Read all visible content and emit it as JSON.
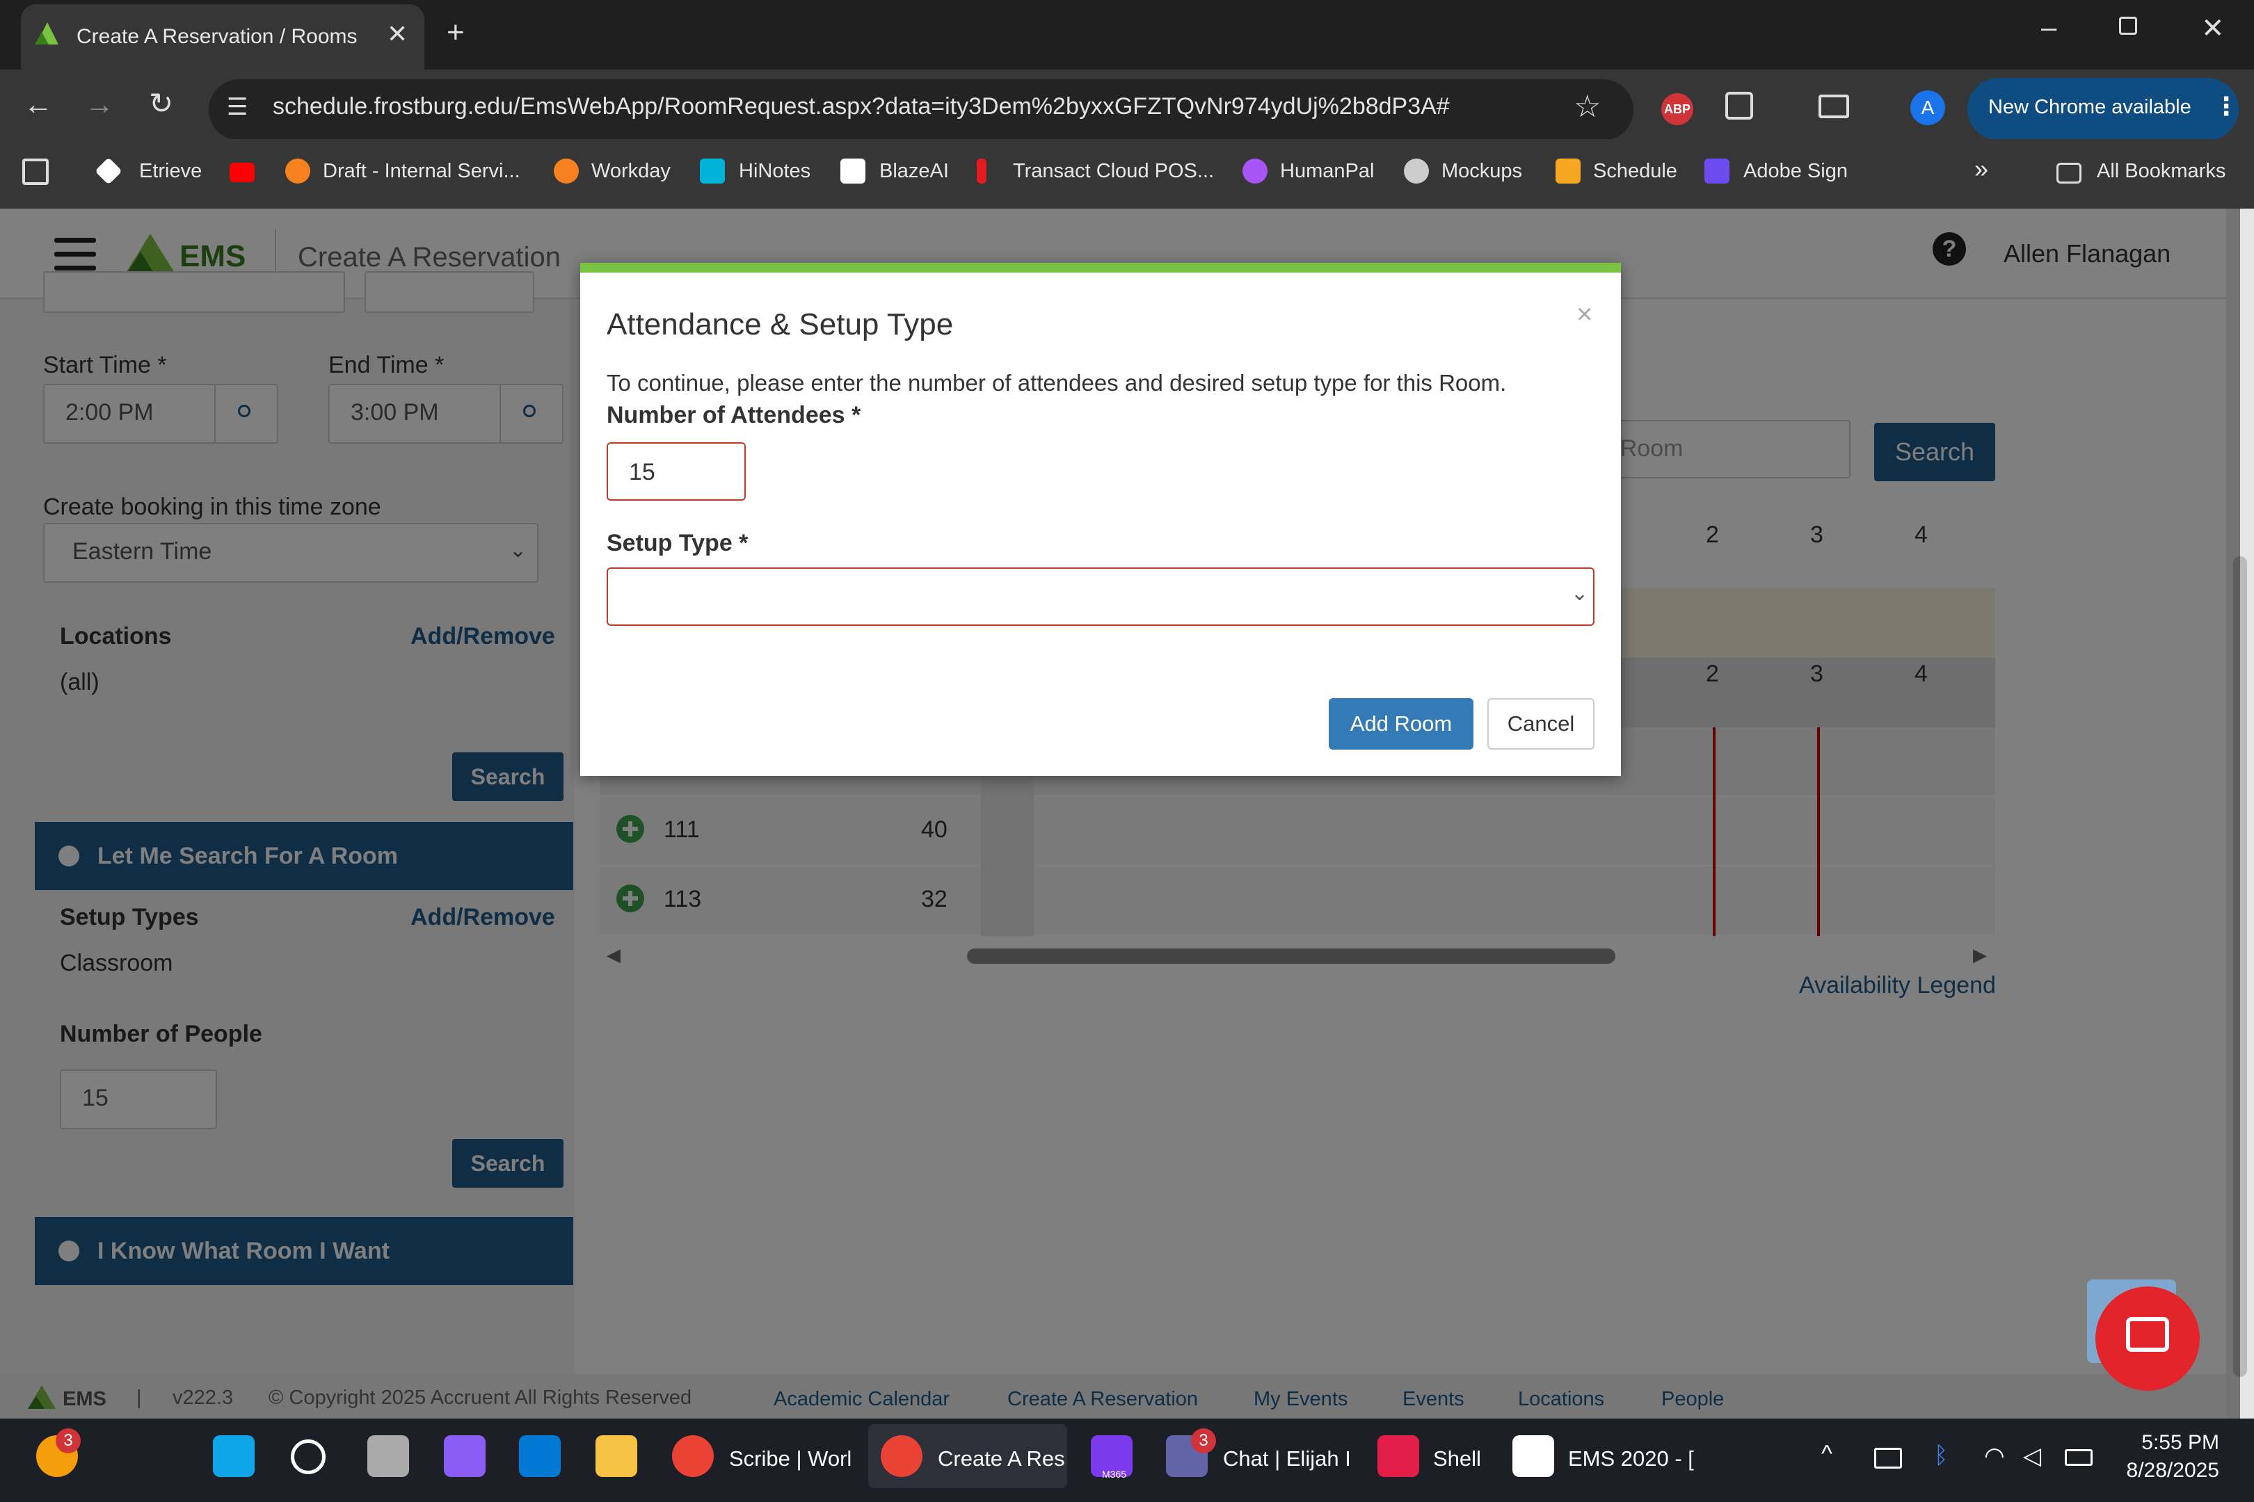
{
  "browser": {
    "tab_title": "Create A Reservation / Rooms",
    "url": "schedule.frostburg.edu/EmsWebApp/RoomRequest.aspx?data=ity3Dem%2byxxGFZTQvNr974ydUj%2b8dP3A#",
    "new_chrome": "New Chrome available",
    "profile_initial": "A",
    "abp": "ABP",
    "bookmarks": [
      "Etrieve",
      "Draft - Internal Servi...",
      "Workday",
      "HiNotes",
      "BlazeAI",
      "Transact Cloud POS...",
      "HumanPal",
      "Mockups",
      "Schedule",
      "Adobe Sign"
    ],
    "all_bookmarks": "All Bookmarks",
    "more": "»"
  },
  "header": {
    "logo": "EMS",
    "title": "Create A Reservation",
    "user": "Allen Flanagan",
    "help": "?"
  },
  "left": {
    "start_label": "Start Time *",
    "start_value": "2:00 PM",
    "end_label": "End Time *",
    "end_value": "3:00 PM",
    "tz_label": "Create booking in this time zone",
    "tz_value": "Eastern Time",
    "locations_label": "Locations",
    "add_remove": "Add/Remove",
    "locations_value": "(all)",
    "search": "Search",
    "panel1": "Let Me Search For A Room",
    "setup_label": "Setup Types",
    "setup_value": "Classroom",
    "people_label": "Number of People",
    "people_value": "15",
    "panel2": "I Know What Room I Want"
  },
  "grid": {
    "search_placeholder": "d A Room",
    "search_btn": "Search",
    "hours": [
      "2",
      "3",
      "4"
    ],
    "rows": [
      {
        "room": "111",
        "cap": "40"
      },
      {
        "room": "113",
        "cap": "32"
      }
    ],
    "legend": "Availability Legend"
  },
  "modal": {
    "title": "Attendance & Setup Type",
    "close": "×",
    "desc": "To continue, please enter the number of attendees and desired setup type for this Room.",
    "attendees_label": "Number of Attendees *",
    "attendees_value": "15",
    "setup_label": "Setup Type *",
    "add_room": "Add Room",
    "cancel": "Cancel"
  },
  "footer": {
    "logo": "EMS",
    "version": "v222.3",
    "sep": "|",
    "copyright": "© Copyright 2025 Accruent All Rights Reserved",
    "links": [
      "Academic Calendar",
      "Create A Reservation",
      "My Events",
      "Events",
      "Locations",
      "People"
    ]
  },
  "taskbar": {
    "items": [
      "Scribe | Worl",
      "Create A Res",
      "Chat | Elijah I",
      "Shell",
      "EMS 2020 - ["
    ],
    "badge_copilot": "3",
    "badge_teams": "3",
    "m365": "M365",
    "time": "5:55 PM",
    "date": "8/28/2025"
  },
  "colors": {
    "accent": "#1f5a8a",
    "modal_top": "#7cc242",
    "error_border": "#c0392b",
    "add_room": "#337ab7"
  }
}
